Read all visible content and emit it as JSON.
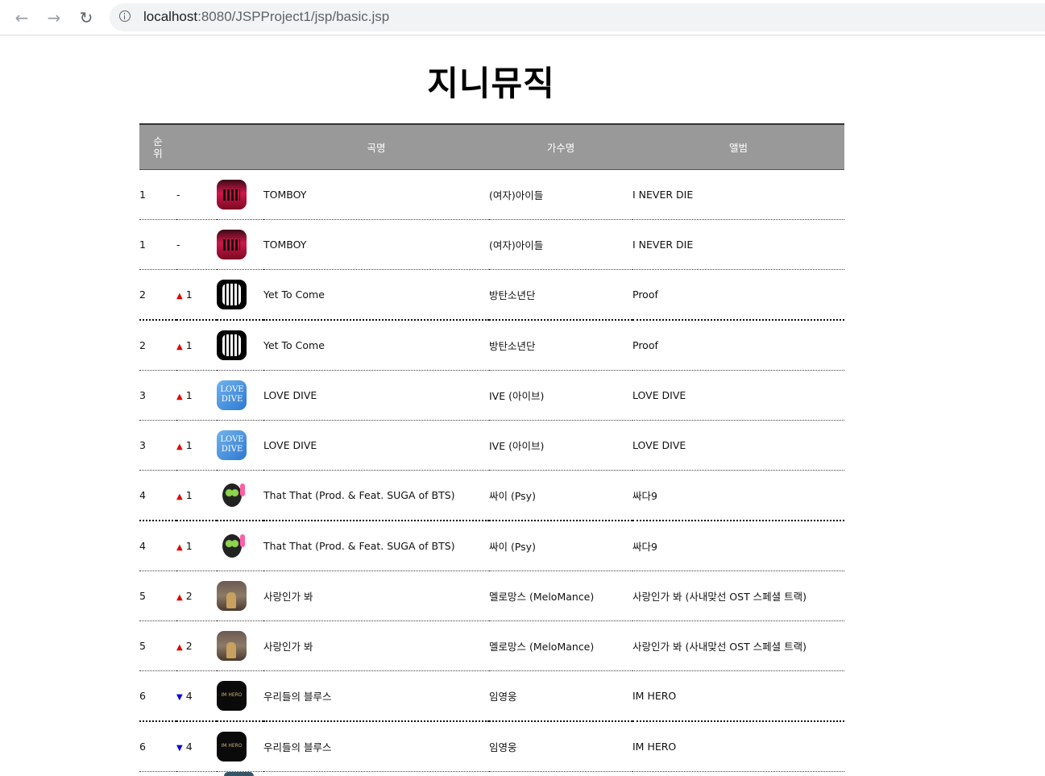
{
  "browser": {
    "url_host": "localhost",
    "url_rest": ":8080/JSPProject1/jsp/basic.jsp"
  },
  "page": {
    "title": "지니뮤직"
  },
  "table": {
    "headers": {
      "rank_line1": "순",
      "rank_line2": "위",
      "title": "곡명",
      "artist": "가수명",
      "album": "앨범"
    },
    "rows": [
      {
        "rank": "1",
        "change_dir": "none",
        "change": "-",
        "cover": "tomboy",
        "title": "TOMBOY",
        "artist": "(여자)아이들",
        "album": "I NEVER DIE"
      },
      {
        "rank": "1",
        "change_dir": "none",
        "change": "-",
        "cover": "tomboy",
        "title": "TOMBOY",
        "artist": "(여자)아이들",
        "album": "I NEVER DIE"
      },
      {
        "rank": "2",
        "change_dir": "up",
        "change": "1",
        "cover": "bts",
        "title": "Yet To Come",
        "artist": "방탄소년단",
        "album": "Proof"
      },
      {
        "rank": "2",
        "change_dir": "up",
        "change": "1",
        "cover": "bts",
        "title": "Yet To Come",
        "artist": "방탄소년단",
        "album": "Proof"
      },
      {
        "rank": "3",
        "change_dir": "up",
        "change": "1",
        "cover": "ive",
        "title": "LOVE DIVE",
        "artist": "IVE (아이브)",
        "album": "LOVE DIVE"
      },
      {
        "rank": "3",
        "change_dir": "up",
        "change": "1",
        "cover": "ive",
        "title": "LOVE DIVE",
        "artist": "IVE (아이브)",
        "album": "LOVE DIVE"
      },
      {
        "rank": "4",
        "change_dir": "up",
        "change": "1",
        "cover": "psy",
        "title": "That That (Prod. & Feat. SUGA of BTS)",
        "artist": "싸이 (Psy)",
        "album": "싸다9"
      },
      {
        "rank": "4",
        "change_dir": "up",
        "change": "1",
        "cover": "psy",
        "title": "That That (Prod. & Feat. SUGA of BTS)",
        "artist": "싸이 (Psy)",
        "album": "싸다9"
      },
      {
        "rank": "5",
        "change_dir": "up",
        "change": "2",
        "cover": "melo",
        "title": "사랑인가 봐",
        "artist": "멜로망스 (MeloMance)",
        "album": "사랑인가 봐 (사내맞선 OST 스페셜 트랙)"
      },
      {
        "rank": "5",
        "change_dir": "up",
        "change": "2",
        "cover": "melo",
        "title": "사랑인가 봐",
        "artist": "멜로망스 (MeloMance)",
        "album": "사랑인가 봐 (사내맞선 OST 스페셜 트랙)"
      },
      {
        "rank": "6",
        "change_dir": "down",
        "change": "4",
        "cover": "lim",
        "title": "우리들의 블루스",
        "artist": "임영웅",
        "album": "IM HERO"
      },
      {
        "rank": "6",
        "change_dir": "down",
        "change": "4",
        "cover": "lim",
        "title": "우리들의 블루스",
        "artist": "임영웅",
        "album": "IM HERO"
      }
    ],
    "up_color": "#e00000",
    "down_color": "#0000e0",
    "header_bg": "#999999"
  }
}
